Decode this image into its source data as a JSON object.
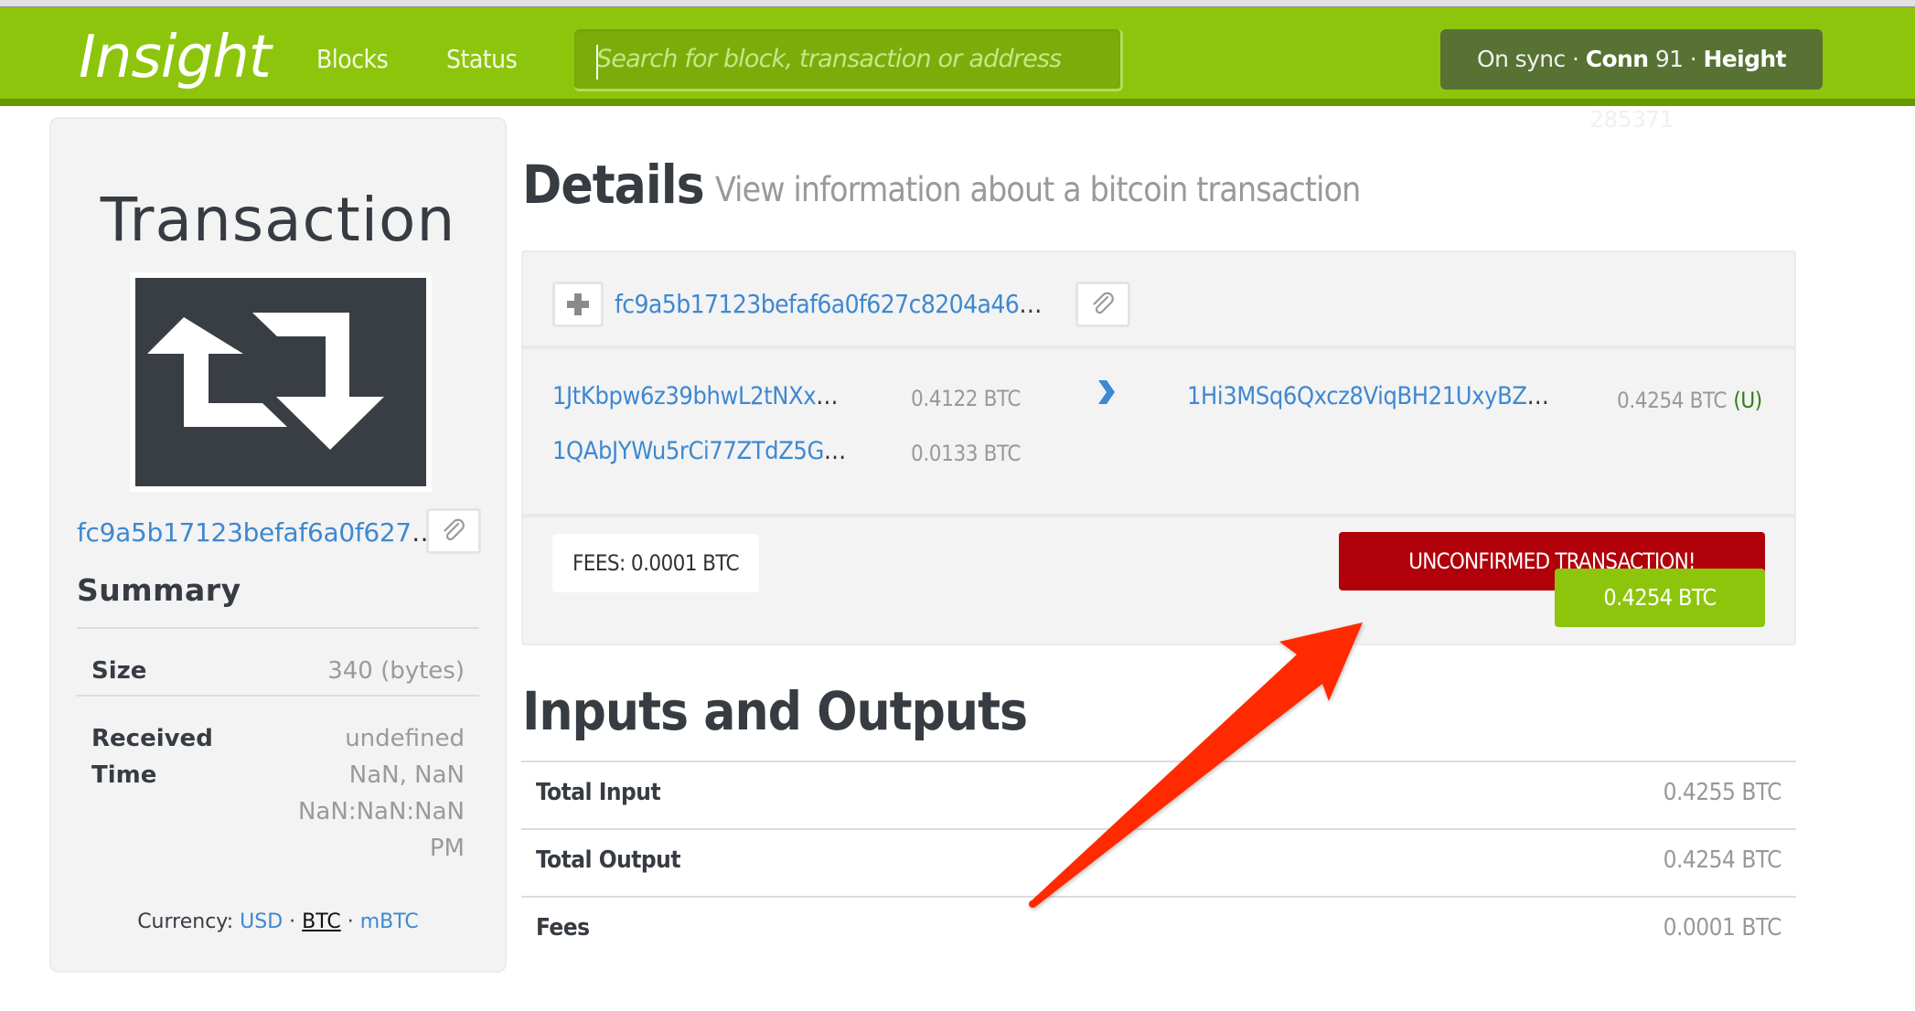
{
  "navbar": {
    "brand": "Insight",
    "links": [
      {
        "label": "Blocks"
      },
      {
        "label": "Status"
      }
    ],
    "search_placeholder": "Search for block, transaction or address",
    "search_value": "",
    "status": {
      "sync": "On sync",
      "separator": " · ",
      "conn_label": "Conn",
      "conn_value": "91",
      "height_label": "Height",
      "height_value": "285371"
    }
  },
  "sidebar": {
    "title": "Transaction",
    "image_icon": "retweet-transaction-icon",
    "hash_display": "fc9a5b17123befaf6a0f627",
    "ellipsis": "…",
    "copy_icon": "paperclip-icon",
    "summary_title": "Summary",
    "summary": [
      {
        "label": "Size",
        "value": "340 (bytes)"
      },
      {
        "label_lines": [
          "Received",
          "Time"
        ],
        "value_lines": [
          "undefined",
          "NaN, NaN",
          "NaN:NaN:NaN",
          "PM"
        ]
      }
    ],
    "currency": {
      "label": "Currency:",
      "options": [
        "USD",
        "BTC",
        "mBTC"
      ],
      "selected": "BTC",
      "separator": "·"
    }
  },
  "main": {
    "details_title": "Details",
    "details_subtitle": "View information about a bitcoin transaction",
    "transaction": {
      "expand_icon": "plus-icon",
      "hash_display": "fc9a5b17123befaf6a0f627c8204a46",
      "ellipsis": "…",
      "copy_icon": "paperclip-icon",
      "inputs": [
        {
          "address": "1JtKbpw6z39bhwL2tNXx",
          "amount": "0.4122 BTC"
        },
        {
          "address": "1QAbJYWu5rCi77ZTdZ5G",
          "amount": "0.0133 BTC"
        }
      ],
      "direction_icon": "chevron-right-icon",
      "outputs": [
        {
          "address": "1Hi3MSq6Qxcz8ViqBH21UxyBZ",
          "amount": "0.4254 BTC",
          "status": "(U)"
        }
      ],
      "fees": "FEES: 0.0001 BTC",
      "unconfirmed_label": "UNCONFIRMED TRANSACTION!",
      "total_output": "0.4254 BTC"
    },
    "io_title": "Inputs and Outputs",
    "io_rows": [
      {
        "label": "Total Input",
        "value": "0.4255 BTC"
      },
      {
        "label": "Total Output",
        "value": "0.4254 BTC"
      },
      {
        "label": "Fees",
        "value": "0.0001 BTC"
      }
    ]
  },
  "annotation": {
    "type": "arrow",
    "color": "#ff2a00",
    "points_to": "unconfirmed-transaction-badge"
  },
  "colors": {
    "navbar_green": "#8dc50c",
    "navbar_dark_green": "#669900",
    "status_pill": "#577233",
    "link_blue": "#3e88d1",
    "unconfirmed_red": "#b0000a",
    "text_dark": "#373c43",
    "muted": "#999999"
  }
}
